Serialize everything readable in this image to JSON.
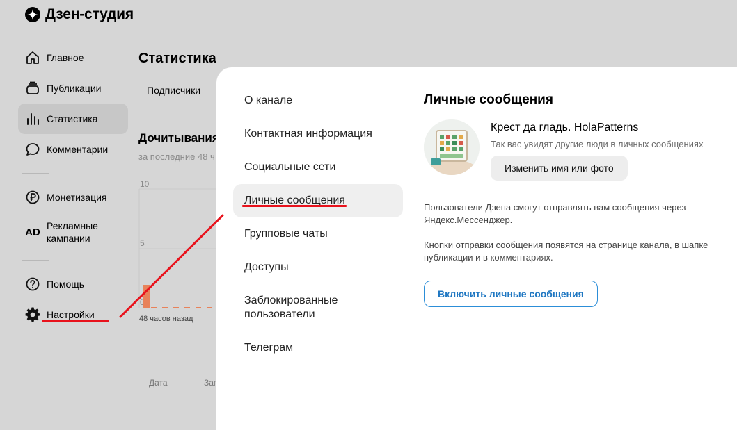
{
  "app": {
    "title": "Дзен-студия"
  },
  "sidebar": {
    "items": [
      {
        "label": "Главное",
        "icon": "home-icon"
      },
      {
        "label": "Публикации",
        "icon": "publications-icon"
      },
      {
        "label": "Статистика",
        "icon": "stats-icon",
        "active": true
      },
      {
        "label": "Комментарии",
        "icon": "comment-icon"
      },
      {
        "label": "Монетизация",
        "icon": "ruble-icon"
      },
      {
        "label": "Рекламные кампании",
        "icon": "ad-icon",
        "icon_text": "AD"
      },
      {
        "label": "Помощь",
        "icon": "help-icon"
      },
      {
        "label": "Настройки",
        "icon": "gear-icon"
      }
    ]
  },
  "main": {
    "title": "Статистика",
    "tab": "Подписчики",
    "section_title": "Дочитывания",
    "section_sub": "за последние 48 ч",
    "chart": {
      "y_ticks": [
        "10",
        "5",
        "0"
      ],
      "time_label": "48 часов назад"
    },
    "table_headers": [
      "Дата",
      "Заг"
    ]
  },
  "modal": {
    "menu": [
      {
        "label": "О канале"
      },
      {
        "label": "Контактная информация"
      },
      {
        "label": "Социальные сети"
      },
      {
        "label": "Личные сообщения",
        "active": true
      },
      {
        "label": "Групповые чаты"
      },
      {
        "label": "Доступы"
      },
      {
        "label": "Заблокированные пользователи"
      },
      {
        "label": "Телеграм"
      }
    ],
    "content": {
      "title": "Личные сообщения",
      "channel_name": "Крест да гладь. HolaPatterns",
      "channel_hint": "Так вас увидят другие люди в личных сообщениях",
      "change_button": "Изменить имя или фото",
      "para1": "Пользователи Дзена смогут отправлять вам сообщения через Яндекс.Мессенджер.",
      "para2": "Кнопки отправки сообщения появятся на странице канала, в шапке публикации и в комментариях.",
      "enable_button": "Включить личные сообщения"
    }
  },
  "colors": {
    "accent": "#1f77c2",
    "annotation": "#e8121c",
    "active_bg": "#efefef"
  }
}
